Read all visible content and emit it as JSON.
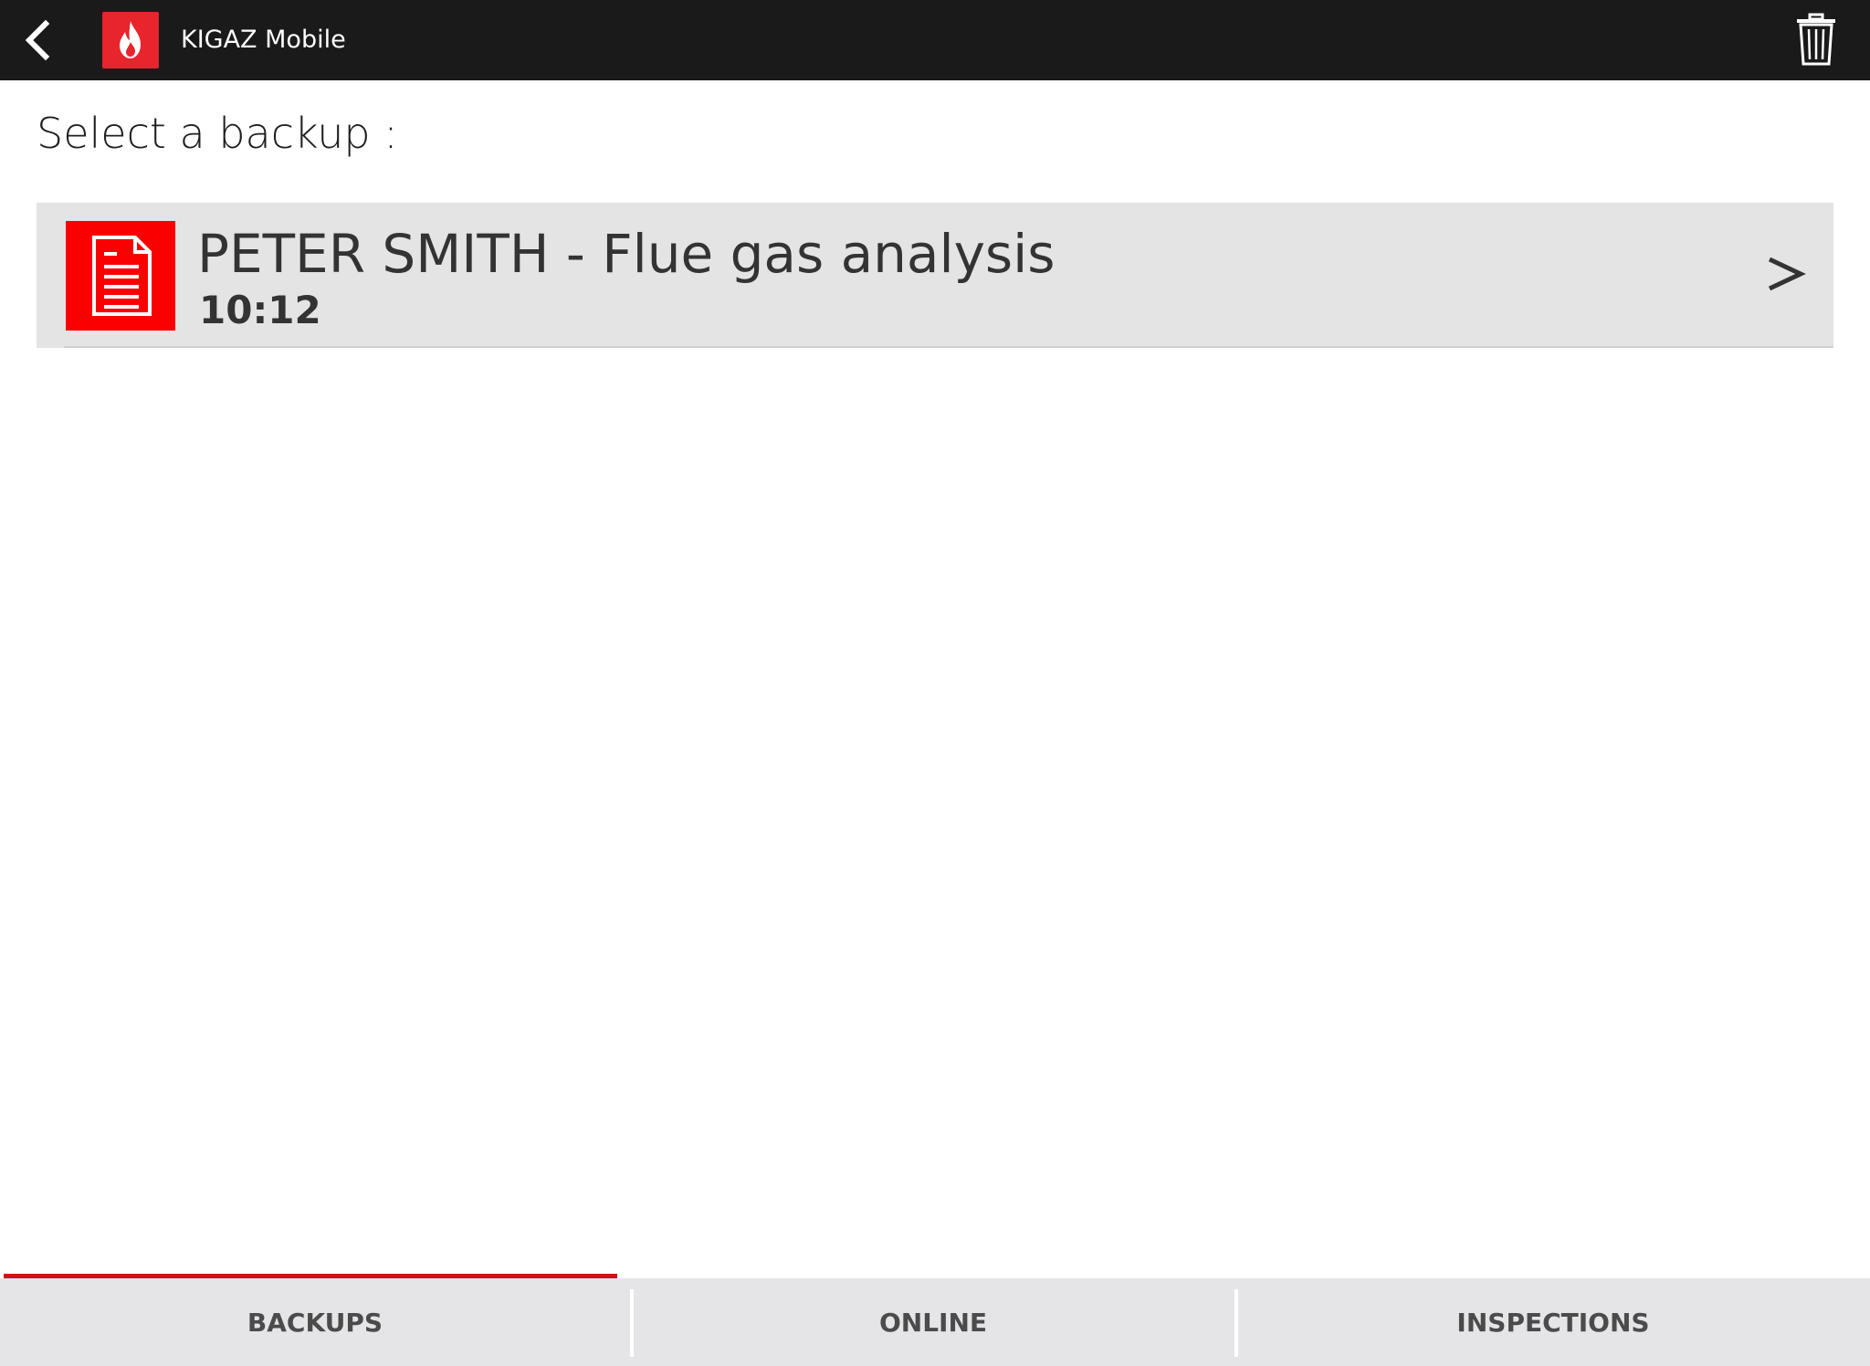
{
  "header": {
    "app_title": "KIGAZ Mobile",
    "back_icon": "back-arrow-icon",
    "app_icon": "flame-icon",
    "delete_icon": "trash-icon"
  },
  "main": {
    "heading": "Select a backup :",
    "backups": [
      {
        "title": "PETER SMITH - Flue gas analysis",
        "time": "10:12",
        "icon": "document-icon",
        "chevron": ">"
      }
    ]
  },
  "tabs": [
    {
      "label": "BACKUPS",
      "active": true
    },
    {
      "label": "ONLINE",
      "active": false
    },
    {
      "label": "INSPECTIONS",
      "active": false
    }
  ],
  "colors": {
    "header_bg": "#1a1a1a",
    "accent_red": "#e8242c",
    "active_tab_indicator": "#d0121b",
    "item_bg": "#e4e4e4",
    "tabbar_bg": "#e5e5e8"
  }
}
